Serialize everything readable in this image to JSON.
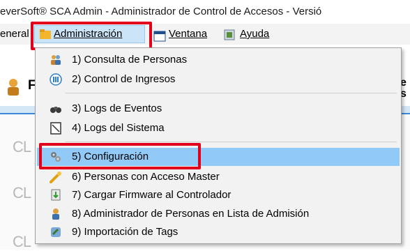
{
  "window": {
    "title": "everSoft® SCA Admin - Administrador de Control de Accesos  -  Versió"
  },
  "menubar": {
    "items": [
      {
        "label": "eneral",
        "icon": ""
      },
      {
        "label": "Administración",
        "icon": "folder-icon"
      },
      {
        "label": "Ventana",
        "icon": "window-icon"
      },
      {
        "label": "Ayuda",
        "icon": "help-book-icon"
      }
    ]
  },
  "background": {
    "section_letter": "F",
    "right_text_1": "e",
    "right_text_2": "s",
    "cl_labels": [
      "CL",
      "CL",
      "CL"
    ]
  },
  "dropdown": {
    "items": [
      {
        "label": "1) Consulta de Personas",
        "icon": "people-icon"
      },
      {
        "label": "2) Control de Ingresos",
        "icon": "control-icon"
      },
      {
        "label": "3) Logs de Eventos",
        "icon": "binoculars-icon"
      },
      {
        "label": "4) Logs del Sistema",
        "icon": "document-icon"
      },
      {
        "label": "5) Configuración",
        "icon": "settings-icon"
      },
      {
        "label": "6) Personas con Acceso Master",
        "icon": "key-icon"
      },
      {
        "label": "7) Cargar Firmware al Controlador",
        "icon": "download-icon"
      },
      {
        "label": "8) Administrador de Personas en Lista de Admisión",
        "icon": "admin-person-icon"
      },
      {
        "label": "9) Importación de Tags",
        "icon": "import-icon"
      }
    ]
  },
  "colors": {
    "highlight": "#91c9f7",
    "annotation_red": "#e3001b",
    "menu_selected": "#cce4f7"
  }
}
